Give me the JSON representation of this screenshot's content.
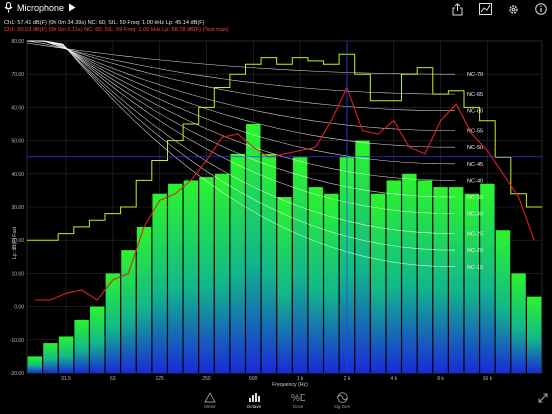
{
  "toolbar": {
    "source_label": "Microphone",
    "play_icon": "play-icon",
    "icons": [
      "share-icon",
      "chart-settings-icon",
      "gear-icon",
      "info-icon"
    ]
  },
  "status": {
    "line1": "Ch1: 57.41 dB(F) (0h  0m 34.39s)    NC: 60, SIL: 59    Freq: 1.00 kHz  Lp: 45.14 dB(F)",
    "line2": "Ch1: 60.03 dB(F) (0h  0m 0.11s)    NC: 60, SIL: 59    Freq: 1.00 kHz  Lp: 58.78 dB(F)  (Test max)"
  },
  "tabs": [
    {
      "label": "Meter",
      "icon": "meter-icon",
      "active": false
    },
    {
      "label": "Octave",
      "icon": "octave-icon",
      "active": true
    },
    {
      "label": "Dose",
      "icon": "dose-icon",
      "active": false
    },
    {
      "label": "Sig Gen",
      "icon": "signal-generator-icon",
      "active": false
    }
  ],
  "colors": {
    "bar_top": "#2bf52b",
    "bar_bottom": "#1a2ad8",
    "max_line": "#e01f1f",
    "nc_curve": "#ffffff",
    "peak_hold": "#c8f020",
    "cursor": "#2a3dff"
  },
  "chart_data": {
    "type": "bar",
    "ylabel": "Lp: dB(F) Fast",
    "xlabel": "Frequency (Hz)",
    "ylim": [
      -20,
      80
    ],
    "yticks": [
      "80.00",
      "70.00",
      "60.00",
      "50.00",
      "40.00",
      "30.00",
      "20.00",
      "10.00",
      "0.00",
      "-10.00",
      "-20.00"
    ],
    "xticks": [
      "31.5",
      "63",
      "125",
      "250",
      "500",
      "1 k",
      "2 k",
      "4 k",
      "8 k",
      "16 k"
    ],
    "bands": 30,
    "bar_values": [
      -15,
      -11,
      -9,
      -4,
      0,
      10,
      17,
      24,
      34,
      37,
      38,
      39,
      40,
      46,
      55,
      46,
      33,
      45,
      36,
      34,
      45,
      50,
      34,
      38,
      40,
      38,
      36,
      36,
      34,
      37,
      23,
      10,
      3
    ],
    "series": [
      {
        "name": "max",
        "values": [
          2,
          2,
          4,
          5,
          2,
          8,
          10,
          24,
          32,
          34,
          38,
          44,
          51,
          52,
          48,
          45,
          46,
          47,
          48,
          56,
          66,
          53,
          52,
          56,
          48,
          46,
          56,
          61,
          52,
          47,
          40,
          33,
          20
        ]
      },
      {
        "name": "peak_hold",
        "values": [
          20,
          20,
          22,
          24,
          26,
          28,
          30,
          38,
          44,
          50,
          55,
          60,
          66,
          70,
          73,
          75,
          73,
          75,
          74,
          73,
          76,
          70,
          62,
          62,
          70,
          72,
          64,
          65,
          60,
          56,
          45,
          34,
          30
        ]
      }
    ],
    "nc_curves": [
      {
        "name": "NC-70",
        "end_value": 70
      },
      {
        "name": "NC-65",
        "end_value": 64
      },
      {
        "name": "NC-60",
        "end_value": 59
      },
      {
        "name": "NC-55",
        "end_value": 53
      },
      {
        "name": "NC-50",
        "end_value": 48
      },
      {
        "name": "NC-45",
        "end_value": 43
      },
      {
        "name": "NC-40",
        "end_value": 38
      },
      {
        "name": "NC-35",
        "end_value": 33
      },
      {
        "name": "NC-30",
        "end_value": 28
      },
      {
        "name": "NC-25",
        "end_value": 22
      },
      {
        "name": "NC-20",
        "end_value": 17
      },
      {
        "name": "NC-15",
        "end_value": 12
      }
    ],
    "cursor": {
      "band": "1 k",
      "value": 45.14
    },
    "grid": true
  }
}
